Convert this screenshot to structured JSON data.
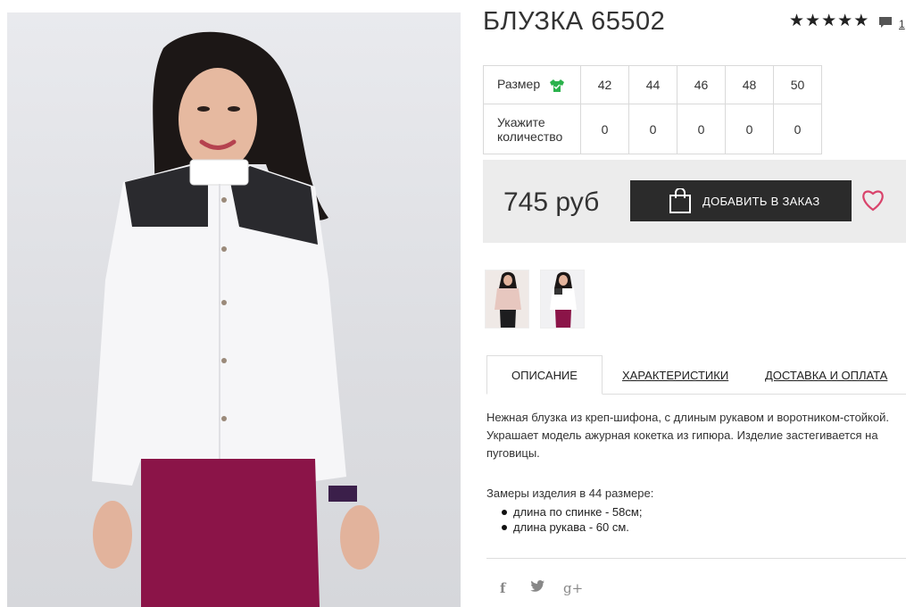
{
  "product": {
    "title": "БЛУЗКА 65502",
    "rating_stars": 5,
    "comments_count": "1"
  },
  "sizes": {
    "size_label": "Размер",
    "qty_label": "Укажите количество",
    "values": [
      "42",
      "44",
      "46",
      "48",
      "50"
    ],
    "quantities": [
      "0",
      "0",
      "0",
      "0",
      "0"
    ]
  },
  "purchase": {
    "price": "745 руб",
    "add_to_order": "ДОБАВИТЬ В ЗАКАЗ"
  },
  "tabs": [
    {
      "label": "ОПИСАНИЕ",
      "active": true
    },
    {
      "label": "ХАРАКТЕРИСТИКИ",
      "active": false
    },
    {
      "label": "ДОСТАВКА И ОПЛАТА",
      "active": false
    }
  ],
  "description": {
    "text": "Нежная блузка из креп-шифона, с длиным рукавом и воротником-стойкой. Украшает модель ажурная кокетка из гипюра. Изделие застегивается на пуговицы.",
    "measures_title": "Замеры изделия в 44 размере:",
    "measures": [
      "длина по спинке - 58см;",
      "длина рукава - 60 см."
    ]
  },
  "social": {
    "facebook": "f",
    "twitter": "🐦",
    "google": "g+"
  },
  "colors": {
    "button_bg": "#2b2b2b",
    "heart": "#d9436b",
    "size_icon": "#2bb24c",
    "buy_box_bg": "#ececec"
  },
  "icons": [
    "star-icon",
    "comment-icon",
    "shirt-icon",
    "shopping-bag-icon",
    "heart-icon",
    "facebook-icon",
    "twitter-icon",
    "google-plus-icon"
  ]
}
